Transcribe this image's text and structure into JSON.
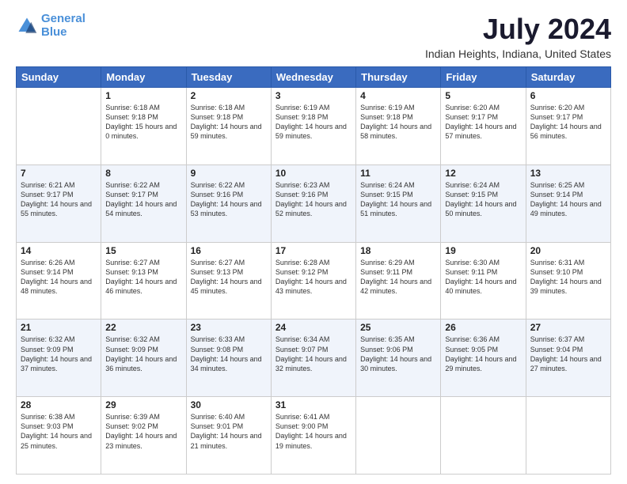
{
  "logo": {
    "line1": "General",
    "line2": "Blue"
  },
  "title": "July 2024",
  "subtitle": "Indian Heights, Indiana, United States",
  "headers": [
    "Sunday",
    "Monday",
    "Tuesday",
    "Wednesday",
    "Thursday",
    "Friday",
    "Saturday"
  ],
  "weeks": [
    [
      {
        "day": "",
        "sunrise": "",
        "sunset": "",
        "daylight": ""
      },
      {
        "day": "1",
        "sunrise": "Sunrise: 6:18 AM",
        "sunset": "Sunset: 9:18 PM",
        "daylight": "Daylight: 15 hours and 0 minutes."
      },
      {
        "day": "2",
        "sunrise": "Sunrise: 6:18 AM",
        "sunset": "Sunset: 9:18 PM",
        "daylight": "Daylight: 14 hours and 59 minutes."
      },
      {
        "day": "3",
        "sunrise": "Sunrise: 6:19 AM",
        "sunset": "Sunset: 9:18 PM",
        "daylight": "Daylight: 14 hours and 59 minutes."
      },
      {
        "day": "4",
        "sunrise": "Sunrise: 6:19 AM",
        "sunset": "Sunset: 9:18 PM",
        "daylight": "Daylight: 14 hours and 58 minutes."
      },
      {
        "day": "5",
        "sunrise": "Sunrise: 6:20 AM",
        "sunset": "Sunset: 9:17 PM",
        "daylight": "Daylight: 14 hours and 57 minutes."
      },
      {
        "day": "6",
        "sunrise": "Sunrise: 6:20 AM",
        "sunset": "Sunset: 9:17 PM",
        "daylight": "Daylight: 14 hours and 56 minutes."
      }
    ],
    [
      {
        "day": "7",
        "sunrise": "Sunrise: 6:21 AM",
        "sunset": "Sunset: 9:17 PM",
        "daylight": "Daylight: 14 hours and 55 minutes."
      },
      {
        "day": "8",
        "sunrise": "Sunrise: 6:22 AM",
        "sunset": "Sunset: 9:17 PM",
        "daylight": "Daylight: 14 hours and 54 minutes."
      },
      {
        "day": "9",
        "sunrise": "Sunrise: 6:22 AM",
        "sunset": "Sunset: 9:16 PM",
        "daylight": "Daylight: 14 hours and 53 minutes."
      },
      {
        "day": "10",
        "sunrise": "Sunrise: 6:23 AM",
        "sunset": "Sunset: 9:16 PM",
        "daylight": "Daylight: 14 hours and 52 minutes."
      },
      {
        "day": "11",
        "sunrise": "Sunrise: 6:24 AM",
        "sunset": "Sunset: 9:15 PM",
        "daylight": "Daylight: 14 hours and 51 minutes."
      },
      {
        "day": "12",
        "sunrise": "Sunrise: 6:24 AM",
        "sunset": "Sunset: 9:15 PM",
        "daylight": "Daylight: 14 hours and 50 minutes."
      },
      {
        "day": "13",
        "sunrise": "Sunrise: 6:25 AM",
        "sunset": "Sunset: 9:14 PM",
        "daylight": "Daylight: 14 hours and 49 minutes."
      }
    ],
    [
      {
        "day": "14",
        "sunrise": "Sunrise: 6:26 AM",
        "sunset": "Sunset: 9:14 PM",
        "daylight": "Daylight: 14 hours and 48 minutes."
      },
      {
        "day": "15",
        "sunrise": "Sunrise: 6:27 AM",
        "sunset": "Sunset: 9:13 PM",
        "daylight": "Daylight: 14 hours and 46 minutes."
      },
      {
        "day": "16",
        "sunrise": "Sunrise: 6:27 AM",
        "sunset": "Sunset: 9:13 PM",
        "daylight": "Daylight: 14 hours and 45 minutes."
      },
      {
        "day": "17",
        "sunrise": "Sunrise: 6:28 AM",
        "sunset": "Sunset: 9:12 PM",
        "daylight": "Daylight: 14 hours and 43 minutes."
      },
      {
        "day": "18",
        "sunrise": "Sunrise: 6:29 AM",
        "sunset": "Sunset: 9:11 PM",
        "daylight": "Daylight: 14 hours and 42 minutes."
      },
      {
        "day": "19",
        "sunrise": "Sunrise: 6:30 AM",
        "sunset": "Sunset: 9:11 PM",
        "daylight": "Daylight: 14 hours and 40 minutes."
      },
      {
        "day": "20",
        "sunrise": "Sunrise: 6:31 AM",
        "sunset": "Sunset: 9:10 PM",
        "daylight": "Daylight: 14 hours and 39 minutes."
      }
    ],
    [
      {
        "day": "21",
        "sunrise": "Sunrise: 6:32 AM",
        "sunset": "Sunset: 9:09 PM",
        "daylight": "Daylight: 14 hours and 37 minutes."
      },
      {
        "day": "22",
        "sunrise": "Sunrise: 6:32 AM",
        "sunset": "Sunset: 9:09 PM",
        "daylight": "Daylight: 14 hours and 36 minutes."
      },
      {
        "day": "23",
        "sunrise": "Sunrise: 6:33 AM",
        "sunset": "Sunset: 9:08 PM",
        "daylight": "Daylight: 14 hours and 34 minutes."
      },
      {
        "day": "24",
        "sunrise": "Sunrise: 6:34 AM",
        "sunset": "Sunset: 9:07 PM",
        "daylight": "Daylight: 14 hours and 32 minutes."
      },
      {
        "day": "25",
        "sunrise": "Sunrise: 6:35 AM",
        "sunset": "Sunset: 9:06 PM",
        "daylight": "Daylight: 14 hours and 30 minutes."
      },
      {
        "day": "26",
        "sunrise": "Sunrise: 6:36 AM",
        "sunset": "Sunset: 9:05 PM",
        "daylight": "Daylight: 14 hours and 29 minutes."
      },
      {
        "day": "27",
        "sunrise": "Sunrise: 6:37 AM",
        "sunset": "Sunset: 9:04 PM",
        "daylight": "Daylight: 14 hours and 27 minutes."
      }
    ],
    [
      {
        "day": "28",
        "sunrise": "Sunrise: 6:38 AM",
        "sunset": "Sunset: 9:03 PM",
        "daylight": "Daylight: 14 hours and 25 minutes."
      },
      {
        "day": "29",
        "sunrise": "Sunrise: 6:39 AM",
        "sunset": "Sunset: 9:02 PM",
        "daylight": "Daylight: 14 hours and 23 minutes."
      },
      {
        "day": "30",
        "sunrise": "Sunrise: 6:40 AM",
        "sunset": "Sunset: 9:01 PM",
        "daylight": "Daylight: 14 hours and 21 minutes."
      },
      {
        "day": "31",
        "sunrise": "Sunrise: 6:41 AM",
        "sunset": "Sunset: 9:00 PM",
        "daylight": "Daylight: 14 hours and 19 minutes."
      },
      {
        "day": "",
        "sunrise": "",
        "sunset": "",
        "daylight": ""
      },
      {
        "day": "",
        "sunrise": "",
        "sunset": "",
        "daylight": ""
      },
      {
        "day": "",
        "sunrise": "",
        "sunset": "",
        "daylight": ""
      }
    ]
  ]
}
